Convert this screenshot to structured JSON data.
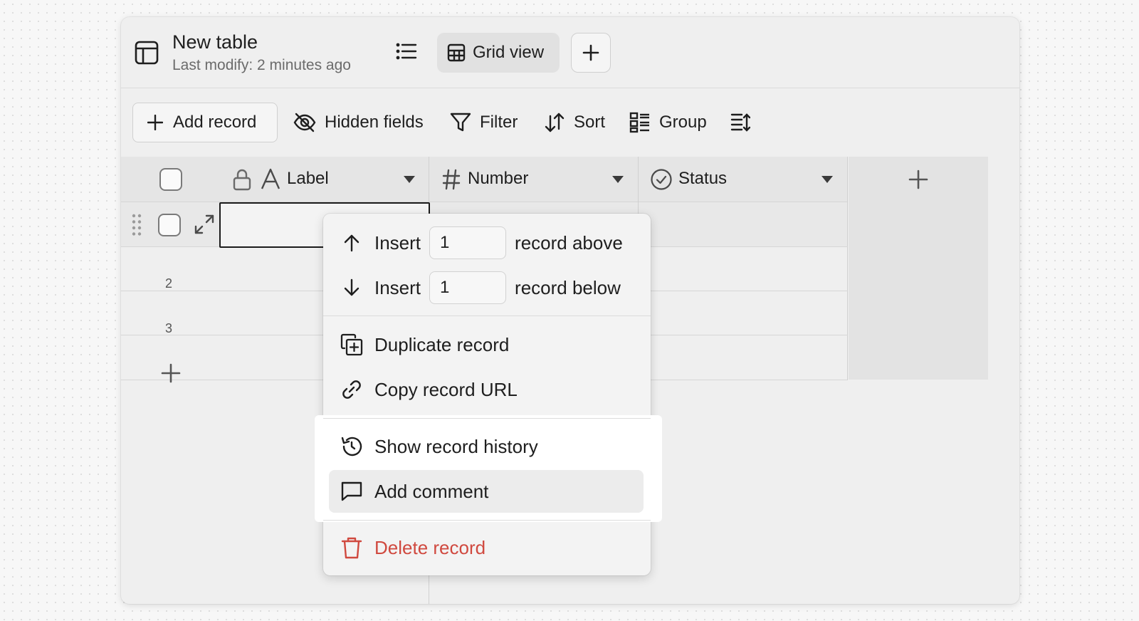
{
  "header": {
    "title": "New table",
    "subtitle": "Last modify: 2 minutes ago",
    "view_label": "Grid view"
  },
  "toolbar": {
    "add_record": "Add record",
    "hidden_fields": "Hidden fields",
    "filter": "Filter",
    "sort": "Sort",
    "group": "Group"
  },
  "grid": {
    "columns": [
      {
        "label": "Label",
        "icon": "text-icon",
        "locked": true
      },
      {
        "label": "Number",
        "icon": "hash-icon"
      },
      {
        "label": "Status",
        "icon": "check-circle-icon"
      }
    ],
    "row_numbers": [
      "2",
      "3"
    ]
  },
  "context_menu": {
    "insert_label": "Insert",
    "insert_above_value": "1",
    "insert_above_suffix": "record above",
    "insert_below_value": "1",
    "insert_below_suffix": "record below",
    "duplicate": "Duplicate record",
    "copy_url": "Copy record URL",
    "show_history": "Show record history",
    "add_comment": "Add comment",
    "delete": "Delete record"
  },
  "colors": {
    "danger": "#d0493f",
    "hover": "#ececec"
  }
}
